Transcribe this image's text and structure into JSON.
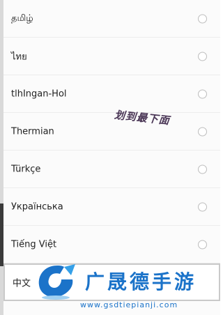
{
  "languages": [
    {
      "label": "தமிழ்",
      "selected": false
    },
    {
      "label": "ไทย",
      "selected": false
    },
    {
      "label": "tlhIngan-Hol",
      "selected": false
    },
    {
      "label": "Thermian",
      "selected": false
    },
    {
      "label": "Türkçe",
      "selected": false
    },
    {
      "label": "Українська",
      "selected": false
    },
    {
      "label": "Tiếng Việt",
      "selected": false
    },
    {
      "label": "中文",
      "selected": true
    }
  ],
  "annotation": {
    "text": "划到最下面"
  },
  "watermark": {
    "title": "广晟德手游",
    "url": "www.gsdtiepianji.com",
    "color": "#1b73c9"
  }
}
